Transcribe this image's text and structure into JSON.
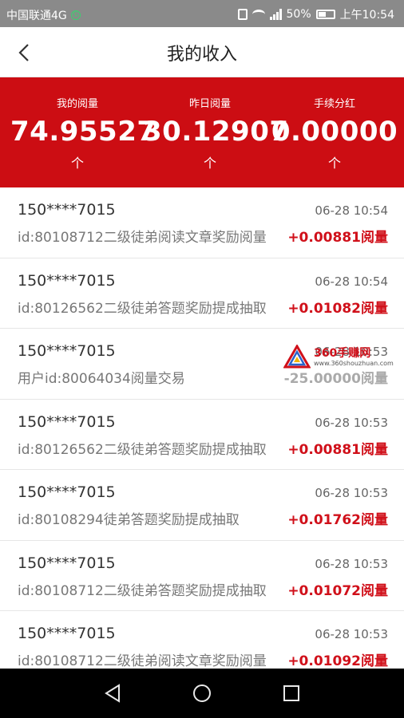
{
  "status_bar": {
    "carrier": "中国联通4G",
    "battery": "50%",
    "time": "上午10:54",
    "network": "4G"
  },
  "nav": {
    "title": "我的收入"
  },
  "stats": [
    {
      "label": "我的阅量",
      "value": "74.95527",
      "arrow": "个"
    },
    {
      "label": "昨日阅量",
      "value": "30.12907",
      "arrow": "个"
    },
    {
      "label": "手续分红",
      "value": "0.00000",
      "arrow": "个"
    }
  ],
  "records": [
    {
      "user": "150****7015",
      "time": "06-28 10:54",
      "desc": "id:80108712二级徒弟阅读文章奖励阅量",
      "amount": "+0.00881阅量"
    },
    {
      "user": "150****7015",
      "time": "06-28 10:54",
      "desc": "id:80126562二级徒弟答题奖励提成抽取",
      "amount": "+0.01082阅量"
    },
    {
      "user": "150****7015",
      "time": "06-28 10:53",
      "desc": "用户id:80064034阅量交易",
      "amount": "-25.00000阅量"
    },
    {
      "user": "150****7015",
      "time": "06-28 10:53",
      "desc": "id:80126562二级徒弟答题奖励提成抽取",
      "amount": "+0.00881阅量"
    },
    {
      "user": "150****7015",
      "time": "06-28 10:53",
      "desc": "id:80108294徒弟答题奖励提成抽取",
      "amount": "+0.01762阅量"
    },
    {
      "user": "150****7015",
      "time": "06-28 10:53",
      "desc": "id:80108712二级徒弟答题奖励提成抽取",
      "amount": "+0.01072阅量"
    },
    {
      "user": "150****7015",
      "time": "06-28 10:53",
      "desc": "id:80108712二级徒弟阅读文章奖励阅量",
      "amount": "+0.01092阅量"
    }
  ],
  "watermark": {
    "name": "360手赚网",
    "url": "www.360shouzhuan.com"
  },
  "colors": {
    "brand_red": "#cc0d13",
    "amount_red": "#d0101a",
    "status_gray": "#8a8a8a"
  },
  "icons": {
    "back": "chevron-left-icon",
    "sys_back": "triangle-back-icon",
    "sys_home": "circle-home-icon",
    "sys_recent": "square-recent-icon"
  }
}
